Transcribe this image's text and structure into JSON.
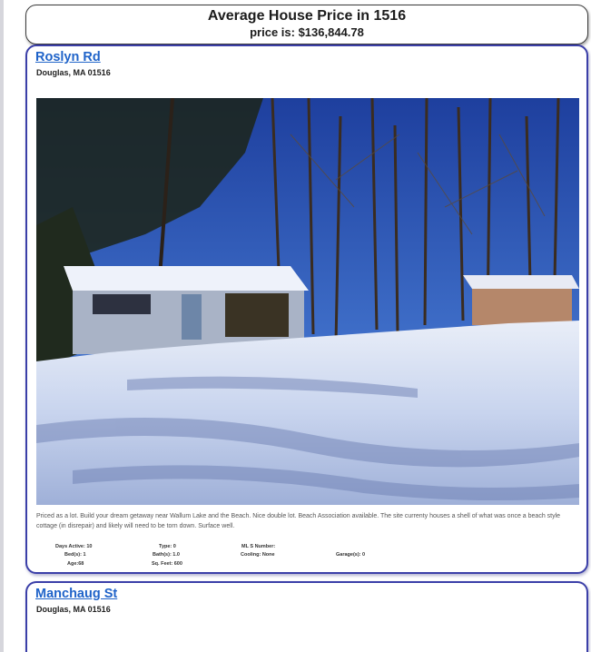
{
  "header": {
    "title": "Average House Price in 1516",
    "price": "price is: $136,844.78"
  },
  "listings": [
    {
      "street": "Roslyn Rd",
      "city": "Douglas, MA 01516",
      "photo_icon": "house-photo",
      "description": "Priced as a lot. Build your dream getaway near Wallum Lake and the Beach. Nice double lot. Beach Association available. The site currenty houses a shell of what was once a beach style cottage (in disrepair) and likely will need to be torn down. Surface well.",
      "facts": {
        "days_active": "Days Active: 10",
        "type": "Type: 0",
        "mls": "ML S Number:",
        "beds": "Bed(s): 1",
        "baths": "Bath(s): 1.0",
        "cooling": "Cooling: None",
        "garage": "Garage(s): 0",
        "age": "Age:68",
        "sqft": "Sq. Feet: 600"
      }
    },
    {
      "street": "Manchaug St",
      "city": "Douglas, MA 01516"
    }
  ],
  "colors": {
    "link": "#1f63c9",
    "card_border": "#3b3fa8"
  }
}
